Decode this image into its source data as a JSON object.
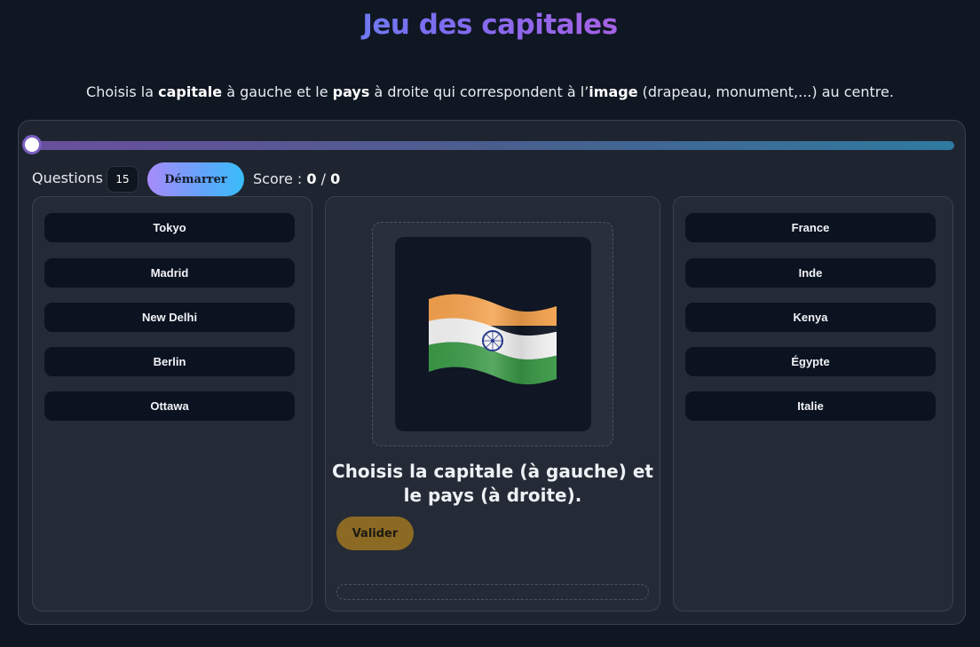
{
  "header": {
    "title": "Jeu des capitales"
  },
  "instructions": {
    "p1": "Choisis la ",
    "b1": "capitale",
    "p2": " à gauche et le ",
    "b2": "pays",
    "p3": " à droite qui correspondent à l’",
    "b3": "image",
    "p4": " (drapeau, monument,...) au centre."
  },
  "controls": {
    "progress": 0,
    "questions_label": "Questions",
    "questions_value": "15",
    "start_label": "Démarrer",
    "score_label": "Score : ",
    "score_current": "0",
    "score_sep": " / ",
    "score_total": "0"
  },
  "capitals": [
    "Tokyo",
    "Madrid",
    "New Delhi",
    "Berlin",
    "Ottawa"
  ],
  "countries": [
    "France",
    "Inde",
    "Kenya",
    "Égypte",
    "Italie"
  ],
  "center": {
    "image_icon": "india-flag-icon",
    "prompt_line1": "Choisis la capitale (à gauche) et",
    "prompt_line2": "le pays (à droite).",
    "validate_label": "Valider"
  },
  "colors": {
    "background": "#0f1722",
    "panel": "#252b36",
    "option": "#0b1220",
    "validate": "#8c6a23",
    "accent_start": "#a78bfa",
    "accent_end": "#38bdf8"
  }
}
